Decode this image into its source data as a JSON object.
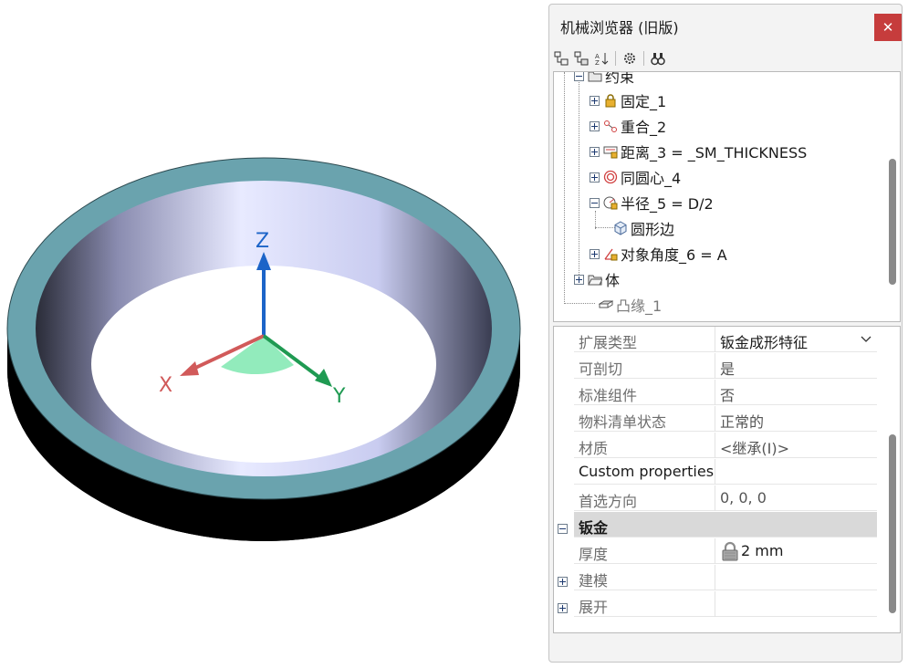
{
  "viewport": {
    "axes": {
      "x_label": "X",
      "y_label": "Y",
      "z_label": "Z"
    },
    "colors": {
      "rim": "#6aa3ae",
      "inner_light": "#e9ebff",
      "inner_dark": "#2e3140",
      "x_axis": "#d15a5a",
      "y_axis": "#1f9a52",
      "z_axis": "#1c64c8",
      "angle": "#7fe8b0"
    }
  },
  "panel": {
    "title": "机械浏览器 (旧版)",
    "close_icon": "close-icon",
    "toolbar": [
      "expand-all-icon",
      "collapse-all-icon",
      "sort-icon",
      "settings-icon",
      "find-icon"
    ],
    "tree": {
      "partial_top": "约束",
      "items": [
        {
          "label": "固定_1",
          "icon": "lock-icon"
        },
        {
          "label": "重合_2",
          "icon": "coincident-icon"
        },
        {
          "label": "距离_3 = _SM_THICKNESS",
          "icon": "distance-icon"
        },
        {
          "label": "同圆心_4",
          "icon": "concentric-icon"
        },
        {
          "label": "半径_5 = D/2",
          "icon": "radius-icon"
        },
        {
          "label": "圆形边",
          "icon": "edge-icon"
        },
        {
          "label": "对象角度_6 = A",
          "icon": "angle-icon"
        },
        {
          "label": "体",
          "icon": "folder-icon"
        },
        {
          "label": "凸缘_1",
          "icon": "flange-icon"
        }
      ]
    },
    "properties": {
      "rows": [
        {
          "name": "扩展类型",
          "value": "钣金成形特征"
        },
        {
          "name": "可剖切",
          "value": "是"
        },
        {
          "name": "标准组件",
          "value": "否"
        },
        {
          "name": "物料清单状态",
          "value": "正常的"
        },
        {
          "name": "材质",
          "value": "<继承(I)>"
        },
        {
          "name": "Custom properties",
          "value": ""
        },
        {
          "name": "首选方向",
          "value": "0, 0, 0"
        }
      ],
      "section": {
        "name": "钣金"
      },
      "thickness": {
        "name": "厚度",
        "value": "2 mm"
      },
      "collapsed": [
        {
          "name": "建模"
        },
        {
          "name": "展开"
        }
      ]
    }
  }
}
